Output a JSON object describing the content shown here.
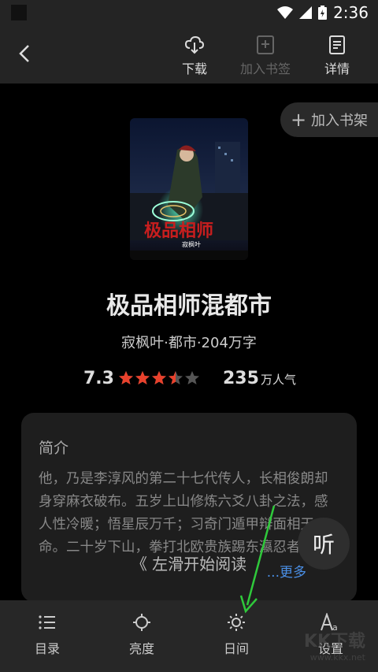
{
  "status_bar": {
    "time": "2:36"
  },
  "toolbar": {
    "download_label": "下载",
    "bookmark_label": "加入书签",
    "details_label": "详情"
  },
  "add_to_shelf_label": "加入书架",
  "cover_text": {
    "title": "极品相师",
    "author": "寂枫叶"
  },
  "book": {
    "title": "极品相师混都市",
    "meta": "寂枫叶·都市·204万字",
    "score": "7.3",
    "rating_stars": 3.5,
    "popularity_value": "235",
    "popularity_unit": "万人气"
  },
  "intro": {
    "heading": "简介",
    "text": "他，乃是李淳风的第二十七代传人，长相俊朗却身穿麻衣破布。五岁上山修炼六爻八卦之法，感人性冷暖；悟星辰万千；习奇门遁甲辩面相天命。二十岁下山，拳打北欧贵族踢东瀛忍者。站在世界巅峰喊话，",
    "more_label": "...更多"
  },
  "swipe_hint": "《 左滑开始阅读",
  "listen_label": "听",
  "bottom_nav": {
    "catalog_label": "目录",
    "brightness_label": "亮度",
    "day_label": "日间",
    "settings_label": "设置"
  },
  "watermark": {
    "brand": "KK下载",
    "url": "www.kkx.net"
  },
  "colors": {
    "star": "#e8412c",
    "link": "#4a8fe6",
    "arrow": "#2fc93b"
  }
}
